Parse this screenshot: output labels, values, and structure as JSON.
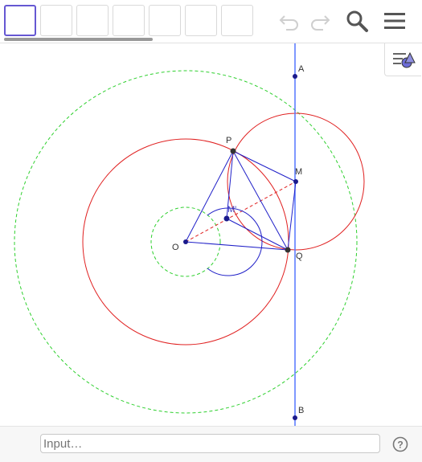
{
  "toolbar": {
    "tools": [
      "move-tool",
      "point-tool",
      "line-tool",
      "perpendicular-tool",
      "polygon-tool",
      "circle-tool",
      "angle-tool"
    ],
    "undo_icon": "undo-icon",
    "redo_icon": "redo-icon",
    "search_icon": "search-icon",
    "menu_icon": "menu-icon",
    "style_icon": "style-bar-icon"
  },
  "geometry": {
    "points": {
      "A": {
        "label": "A"
      },
      "B": {
        "label": "B"
      },
      "P": {
        "label": "P"
      },
      "M": {
        "label": "M"
      },
      "M_prime": {
        "label": "M'"
      },
      "O": {
        "label": "O"
      },
      "Q": {
        "label": "Q"
      }
    },
    "colors": {
      "red": "#e02020",
      "green": "#2fd02f",
      "blue": "#2020c8",
      "line": "#5577ff"
    }
  },
  "input_bar": {
    "placeholder": "Input…",
    "help_icon": "help-icon"
  }
}
